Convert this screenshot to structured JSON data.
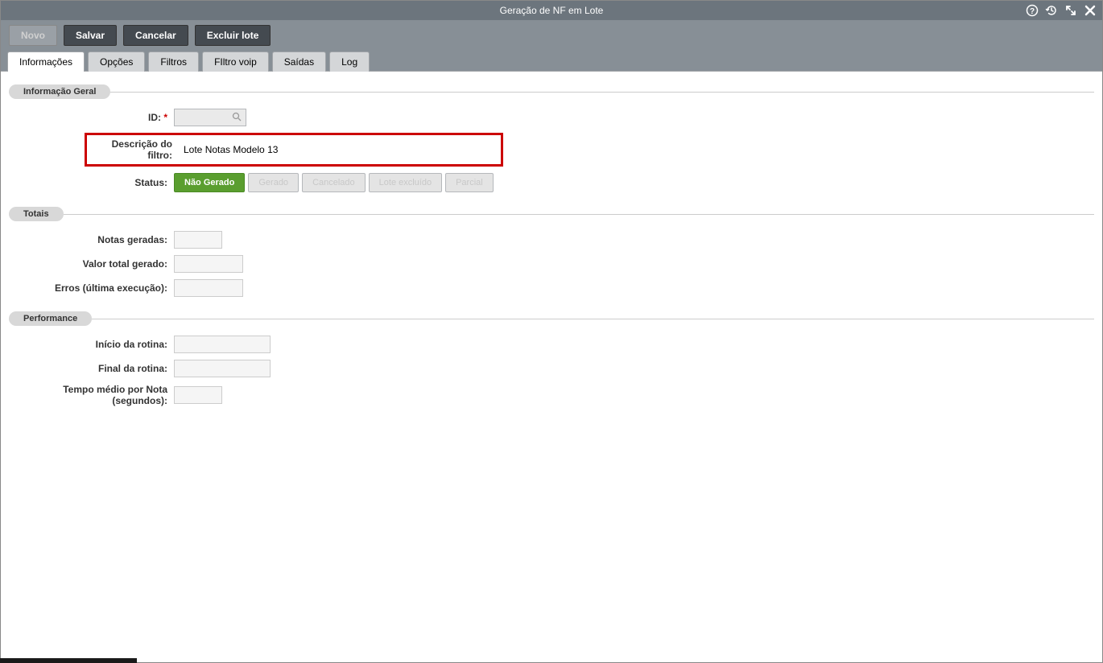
{
  "window": {
    "title": "Geração de NF em Lote"
  },
  "toolbar": {
    "novo": "Novo",
    "salvar": "Salvar",
    "cancelar": "Cancelar",
    "excluir": "Excluir lote"
  },
  "tabs": {
    "informacoes": "Informações",
    "opcoes": "Opções",
    "filtros": "Filtros",
    "filtro_voip": "FIltro voip",
    "saidas": "Saídas",
    "log": "Log"
  },
  "sections": {
    "geral": "Informação Geral",
    "totais": "Totais",
    "performance": "Performance"
  },
  "labels": {
    "id": "ID:",
    "descricao": "Descrição do filtro:",
    "status": "Status:",
    "notas_geradas": "Notas geradas:",
    "valor_total": "Valor total gerado:",
    "erros": "Erros (última execução):",
    "inicio": "Início da rotina:",
    "final": "Final da rotina:",
    "tempo_medio": "Tempo médio por Nota (segundos):"
  },
  "values": {
    "id": "",
    "descricao": "Lote Notas Modelo 13",
    "notas_geradas": "",
    "valor_total": "",
    "erros": "",
    "inicio": "",
    "final": "",
    "tempo_medio": ""
  },
  "status": {
    "nao_gerado": "Não Gerado",
    "gerado": "Gerado",
    "cancelado": "Cancelado",
    "lote_excluido": "Lote excluído",
    "parcial": "Parcial"
  }
}
